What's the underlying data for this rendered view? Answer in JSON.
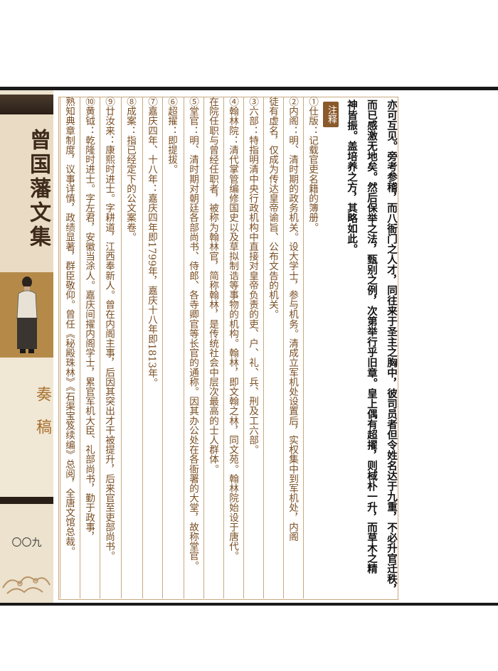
{
  "sidebar": {
    "book_title": "曾国藩文集",
    "section_title": "奏稿",
    "page_number": "〇〇九"
  },
  "notes_label": "注释",
  "main_text": [
    "亦可互见。旁考参稽，而八衙门之人才，同往来于圣主之胸中，彼司员者但令姓名达于九重，不必升官迁秩，",
    "而已感激无地矣。然后保举之法，甄别之例，次第举行乎旧章。皇上偶有超擢，则棫朴一升，而草木之精",
    "神皆振。盖培养之方，其略如此。"
  ],
  "notes": [
    "①仕版：记载官吏名籍的簿册。",
    "②内阁：明、清时期的政务机关。设大学士，参与机务。清成立军机处设置后，实权集中到军机处，内阁",
    "徒有虚名，仅成为传达皇帝谕旨、公布文告的机关。",
    "③六部：特指明清中央行政机构中直接对皇帝负责的吏、户、礼、兵、刑及工六部。",
    "④翰林院：清代掌管编修国史以及草拟制诰等事物的机构。翰林，即文翰之林，同文苑。翰林院始设于唐代。",
    "在院任职与曾经任职者，被称为翰林官，简称翰林，是传统社会中层次最高的士人群体。",
    "⑤堂官：明、清时期对朝廷各部尚书、侍郎、各寺卿官等长官的通称。因其办公处在各衙署的大堂，故称堂官。",
    "⑥超擢：即提拔。",
    "⑦嘉庆四年、十八年：嘉庆四年即1799年，嘉庆十八年即1813年。",
    "⑧成案：指已经定下的公文案卷。",
    "⑨廿汝来：康熙时进士。字耕道，江西奉新人。曾在内阁主事，后因其突出才干被提升，后来官至吏部尚书。",
    "⑩黄钺：乾隆时进士。字左君，安徽当涂人。嘉庆间擢内阁学士，累官军机大臣、礼部尚书，勤于政事，",
    "熟知典章制度，议事详慎，政绩显著，群臣敬仰。曾任《秘殿珠林》《石渠宝笈续编》总阅，全唐文馆总裁。"
  ]
}
